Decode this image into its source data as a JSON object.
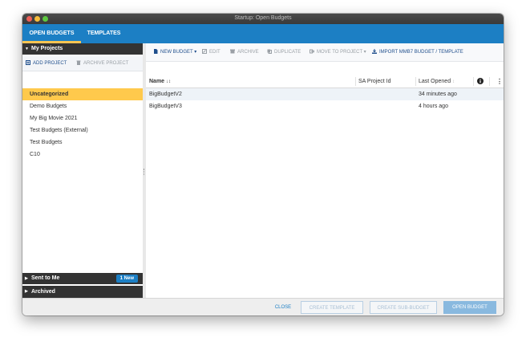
{
  "window": {
    "title": "Startup: Open Budgets"
  },
  "tabs": [
    {
      "label": "OPEN BUDGETS",
      "active": true
    },
    {
      "label": "TEMPLATES",
      "active": false
    }
  ],
  "sidebar": {
    "my_projects_label": "My Projects",
    "add_project_label": "ADD PROJECT",
    "archive_project_label": "ARCHIVE PROJECT",
    "projects": [
      {
        "label": "Uncategorized",
        "selected": true
      },
      {
        "label": "Demo Budgets"
      },
      {
        "label": "My Big Movie 2021"
      },
      {
        "label": "Test Budgets (External)"
      },
      {
        "label": "Test Budgets"
      },
      {
        "label": "C10"
      }
    ],
    "sent_to_me_label": "Sent to Me",
    "sent_to_me_badge": "1 New",
    "archived_label": "Archived"
  },
  "toolbar": {
    "new_budget": "NEW BUDGET",
    "edit": "EDIT",
    "archive": "ARCHIVE",
    "duplicate": "DUPLICATE",
    "move_to_project": "MOVE TO PROJECT",
    "import": "IMPORT MMB7 BUDGET / TEMPLATE"
  },
  "table": {
    "headers": {
      "name": "Name",
      "sa_project_id": "SA Project Id",
      "last_opened": "Last Opened"
    },
    "rows": [
      {
        "name": "BigBudgetV2",
        "sa_project_id": "",
        "last_opened": "34 minutes ago",
        "selected": true
      },
      {
        "name": "BigBudgetV3",
        "sa_project_id": "",
        "last_opened": "4 hours ago"
      }
    ]
  },
  "footer": {
    "close": "CLOSE",
    "create_template": "CREATE TEMPLATE",
    "create_sub_budget": "CREATE SUB-BUDGET",
    "open_budget": "OPEN BUDGET"
  },
  "colors": {
    "brand_blue": "#1c7fc4",
    "selected_yellow": "#f5c452",
    "dark_header": "#333333"
  }
}
